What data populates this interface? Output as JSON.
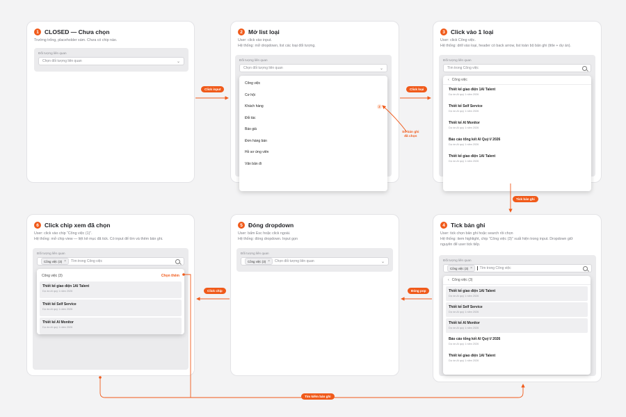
{
  "colors": {
    "accent": "#f05a1a",
    "card": "#ffffff",
    "panel": "#ebebed"
  },
  "field_label": "Đối tượng liên quan",
  "record_sub": "Dự án AI quý 1 năm 2026",
  "steps": [
    {
      "num": "1",
      "title": "CLOSED — Chưa chọn",
      "desc": [
        "Trường trống, placeholder xám. Chưa có chip nào."
      ],
      "input_text": "Chọn đối tượng liên quan"
    },
    {
      "num": "2",
      "title": "Mở list loại",
      "desc": [
        "User: click vào input.",
        "Hệ thống: mở dropdown, list các loại đối tượng."
      ],
      "input_text": "Chọn đối tượng liên quan",
      "types": [
        "Công việc",
        "Cơ hội",
        "Khách hàng",
        "Đối tác",
        "Báo giá",
        "Đơn hàng bán",
        "Hồ sơ ứng viên",
        "Văn bản đi"
      ],
      "count_badge": "2"
    },
    {
      "num": "3",
      "title": "Click vào 1 loại",
      "desc": [
        "User: click Công việc.",
        "Hệ thống: drill vào loại, header có back arrow, list toàn bộ bản ghi (title + dự án)."
      ],
      "input_text": "Tìm trong Công việc",
      "back_label": "Công việc",
      "records": [
        "Thiết kế giao diện 1AI Talent",
        "Thiết kế Self Service",
        "Thiết kế AI Monitor",
        "Báo cáo tổng kết AI Quý I/ 2026",
        "Thiết kế giao diện 1AI Talent"
      ]
    },
    {
      "num": "4",
      "title": "Tick bản ghi",
      "desc": [
        "User: tick chọn bản ghi hoặc search rồi chọn",
        "Hệ thống: item highlight, chip “Công việc (3)” xuất hiện trong input. Dropdown giữ",
        "nguyên để user tick tiếp."
      ],
      "chip": "Công việc (3)",
      "input_text": "Tìm trong Công việc",
      "back_label": "Công việc (3)",
      "records": [
        "Thiết kế giao diện 1AI Talent",
        "Thiết kế Self Service",
        "Thiết kế AI Monitor",
        "Báo cáo tổng kết AI Quý I/ 2026",
        "Thiết kế giao diện 1AI Talent"
      ]
    },
    {
      "num": "5",
      "title": "Đóng dropdown",
      "desc": [
        "User: bấm Esc hoặc click ngoài.",
        "Hệ thống: đóng dropdown. Input gọn"
      ],
      "chip": "Công việc (3)",
      "input_text": "Chọn đối tượng liên quan"
    },
    {
      "num": "6",
      "title": "Click chip xem đã chọn",
      "desc": [
        "User: click vào chip “Công việc (1)”.",
        "Hệ thống: mở chip view — liệt kê mục đã tick. Có input để tìm và thêm bản ghi."
      ],
      "chip": "Công việc (3)",
      "input_text": "Tìm trong Công việc",
      "chosen_label": "Công việc (3)",
      "more_label": "Chọn thêm",
      "records": [
        "Thiết kế giao diện 1AI Talent",
        "Thiết kế Self Service",
        "Thiết kế AI Monitor"
      ]
    }
  ],
  "arrows": {
    "a1": "Click input",
    "a2": "Click loại",
    "a3": "Tick bản ghi",
    "a4": "Đóng pop",
    "a5": "Click chip",
    "a6": "Tìm kiếm bản ghi"
  },
  "annotation": [
    "Số bản ghi",
    "đã chọn"
  ]
}
